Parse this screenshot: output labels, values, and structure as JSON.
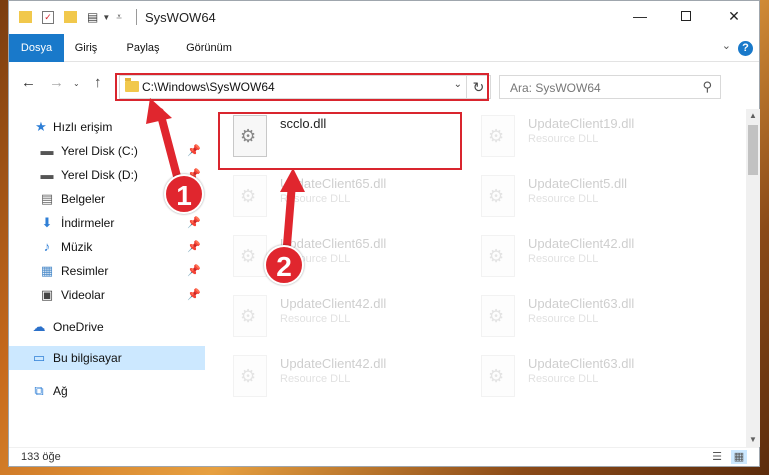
{
  "window": {
    "title": "SysWOW64"
  },
  "ribbon": {
    "tabs": [
      {
        "label": "Dosya",
        "active": true
      },
      {
        "label": "Giriş",
        "active": false
      },
      {
        "label": "Paylaş",
        "active": false
      },
      {
        "label": "Görünüm",
        "active": false
      }
    ]
  },
  "nav": {
    "address": "C:\\Windows\\SysWOW64",
    "search_placeholder": "Ara: SysWOW64"
  },
  "sidebar": {
    "items": [
      {
        "label": "Hızlı erişim",
        "icon": "star-icon"
      },
      {
        "label": "Yerel Disk (C:)",
        "icon": "drive-icon"
      },
      {
        "label": "Yerel Disk (D:)",
        "icon": "drive-icon"
      },
      {
        "label": "Belgeler",
        "icon": "documents-icon"
      },
      {
        "label": "İndirmeler",
        "icon": "download-icon"
      },
      {
        "label": "Müzik",
        "icon": "music-icon"
      },
      {
        "label": "Resimler",
        "icon": "pictures-icon"
      },
      {
        "label": "Videolar",
        "icon": "videos-icon"
      },
      {
        "label": "OneDrive",
        "icon": "cloud-icon"
      },
      {
        "label": "Bu bilgisayar",
        "icon": "computer-icon"
      },
      {
        "label": "Ağ",
        "icon": "network-icon"
      }
    ]
  },
  "files": [
    {
      "name": "scclo.dll",
      "type": ""
    },
    {
      "name": "UpdateClient19.dll",
      "type": "Resource DLL"
    },
    {
      "name": "UpdateClient65.dll",
      "type": "Resource DLL"
    },
    {
      "name": "UpdateClient5.dll",
      "type": "Resource DLL"
    },
    {
      "name": "UpdateClient65.dll",
      "type": "Resource DLL"
    },
    {
      "name": "UpdateClient42.dll",
      "type": "Resource DLL"
    },
    {
      "name": "UpdateClient42.dll",
      "type": "Resource DLL"
    },
    {
      "name": "UpdateClient63.dll",
      "type": "Resource DLL"
    },
    {
      "name": "UpdateClient42.dll",
      "type": "Resource DLL"
    },
    {
      "name": "UpdateClient63.dll",
      "type": "Resource DLL"
    }
  ],
  "status": {
    "count": "133 öğe"
  },
  "annotations": {
    "badge1": "1",
    "badge2": "2",
    "color": "#e0262e"
  },
  "colors": {
    "accent": "#1979ca",
    "selection": "#cce8ff",
    "highlight": "#d9252e"
  }
}
